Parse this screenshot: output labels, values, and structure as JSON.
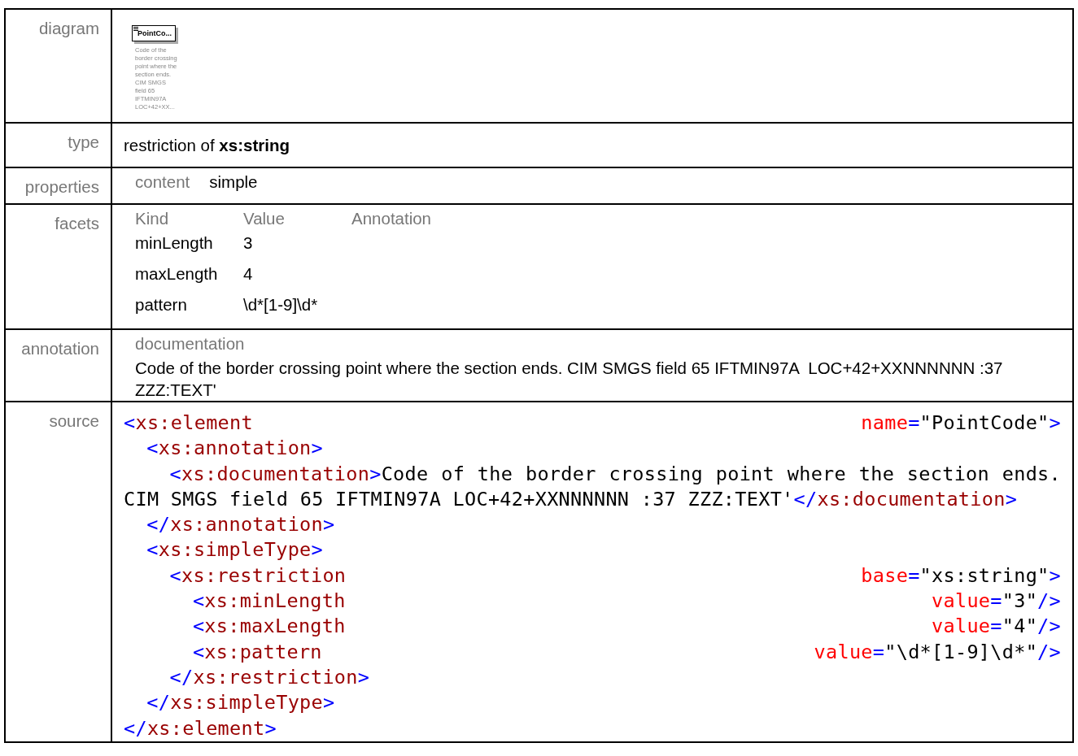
{
  "rows": [
    {
      "kind": "diagram",
      "label": "diagram",
      "diagram": {
        "title": "PointCo...",
        "caption_lines": [
          "Code of the",
          "border crossing",
          "point where the",
          "section ends.",
          "CIM SMGS",
          "field 65",
          "IFTMIN97A",
          "LOC+42+XX..."
        ]
      }
    },
    {
      "kind": "type",
      "label": "type",
      "text": "restriction of **xs:string**"
    },
    {
      "kind": "properties",
      "label": "properties",
      "items": [
        {
          "name": "content",
          "value": "simple"
        }
      ]
    },
    {
      "kind": "facets",
      "label": "facets",
      "columns": [
        "Kind",
        "Value",
        "Annotation"
      ],
      "facets": [
        {
          "kind": "minLength",
          "value": "3"
        },
        {
          "kind": "maxLength",
          "value": "4"
        },
        {
          "kind": "pattern",
          "value": "\\d*[1-9]\\d*"
        }
      ]
    },
    {
      "kind": "annotation",
      "label": "annotation",
      "heading": "documentation",
      "text": "Code of the border crossing point where the section ends. CIM SMGS field 65 IFTMIN97A  LOC+42+XXNNNNNN :37 ZZZ:TEXT'"
    },
    {
      "kind": "source",
      "label": "source",
      "source": {
        "open": [
          {
            "kind": "punct",
            "text": "<"
          },
          {
            "kind": "tag",
            "text": "xs:element"
          }
        ],
        "attrs": [
          {
            "kind": "attr",
            "text": "name"
          },
          {
            "kind": "punct",
            "text": "="
          },
          {
            "kind": "value",
            "text": "\"PointCode\""
          },
          {
            "kind": "punct",
            "text": ">"
          }
        ],
        "close": [
          {
            "kind": "punct",
            "text": "</"
          },
          {
            "kind": "tag",
            "text": "xs:element"
          },
          {
            "kind": "punct",
            "text": ">"
          }
        ],
        "children": [
          {
            "open": [
              {
                "kind": "punct",
                "text": "<"
              },
              {
                "kind": "tag",
                "text": "xs:annotation"
              },
              {
                "kind": "punct",
                "text": ">"
              }
            ],
            "close": [
              {
                "kind": "punct",
                "text": "</"
              },
              {
                "kind": "tag",
                "text": "xs:annotation"
              },
              {
                "kind": "punct",
                "text": ">"
              }
            ],
            "children": [
              {
                "open": [
                  {
                    "kind": "punct",
                    "text": "<"
                  },
                  {
                    "kind": "tag",
                    "text": "xs:documentation"
                  },
                  {
                    "kind": "punct",
                    "text": ">"
                  }
                ],
                "body": [
                  {
                    "kind": "value",
                    "text": "Code of the border crossing point where the section ends. CIM SMGS field 65 IFTMIN97A  LOC+42+XXNNNNNN :37 ZZZ:TEXT'"
                  },
                  {
                    "kind": "punct",
                    "text": "</"
                  },
                  {
                    "kind": "tag",
                    "text": "xs:documentation"
                  },
                  {
                    "kind": "punct",
                    "text": ">"
                  }
                ]
              }
            ]
          },
          {
            "open": [
              {
                "kind": "punct",
                "text": "<"
              },
              {
                "kind": "tag",
                "text": "xs:simpleType"
              },
              {
                "kind": "punct",
                "text": ">"
              }
            ],
            "close": [
              {
                "kind": "punct",
                "text": "</"
              },
              {
                "kind": "tag",
                "text": "xs:simpleType"
              },
              {
                "kind": "punct",
                "text": ">"
              }
            ],
            "children": [
              {
                "open": [
                  {
                    "kind": "punct",
                    "text": "<"
                  },
                  {
                    "kind": "tag",
                    "text": "xs:restriction"
                  }
                ],
                "attrs": [
                  {
                    "kind": "attr",
                    "text": "base"
                  },
                  {
                    "kind": "punct",
                    "text": "="
                  },
                  {
                    "kind": "value",
                    "text": "\"xs:string\""
                  },
                  {
                    "kind": "punct",
                    "text": ">"
                  }
                ],
                "close": [
                  {
                    "kind": "punct",
                    "text": "</"
                  },
                  {
                    "kind": "tag",
                    "text": "xs:restriction"
                  },
                  {
                    "kind": "punct",
                    "text": ">"
                  }
                ],
                "children": [
                  {
                    "open": [
                      {
                        "kind": "punct",
                        "text": "<"
                      },
                      {
                        "kind": "tag",
                        "text": "xs:minLength"
                      }
                    ],
                    "attrs": [
                      {
                        "kind": "attr",
                        "text": "value"
                      },
                      {
                        "kind": "punct",
                        "text": "="
                      },
                      {
                        "kind": "value",
                        "text": "\"3\""
                      },
                      {
                        "kind": "punct",
                        "text": "/>"
                      }
                    ]
                  },
                  {
                    "open": [
                      {
                        "kind": "punct",
                        "text": "<"
                      },
                      {
                        "kind": "tag",
                        "text": "xs:maxLength"
                      }
                    ],
                    "attrs": [
                      {
                        "kind": "attr",
                        "text": "value"
                      },
                      {
                        "kind": "punct",
                        "text": "="
                      },
                      {
                        "kind": "value",
                        "text": "\"4\""
                      },
                      {
                        "kind": "punct",
                        "text": "/>"
                      }
                    ]
                  },
                  {
                    "open": [
                      {
                        "kind": "punct",
                        "text": "<"
                      },
                      {
                        "kind": "tag",
                        "text": "xs:pattern"
                      }
                    ],
                    "attrs": [
                      {
                        "kind": "attr",
                        "text": "value"
                      },
                      {
                        "kind": "punct",
                        "text": "="
                      },
                      {
                        "kind": "value",
                        "text": "\"\\d*[1-9]\\d*\""
                      },
                      {
                        "kind": "punct",
                        "text": "/>"
                      }
                    ]
                  }
                ]
              }
            ]
          }
        ]
      }
    }
  ]
}
